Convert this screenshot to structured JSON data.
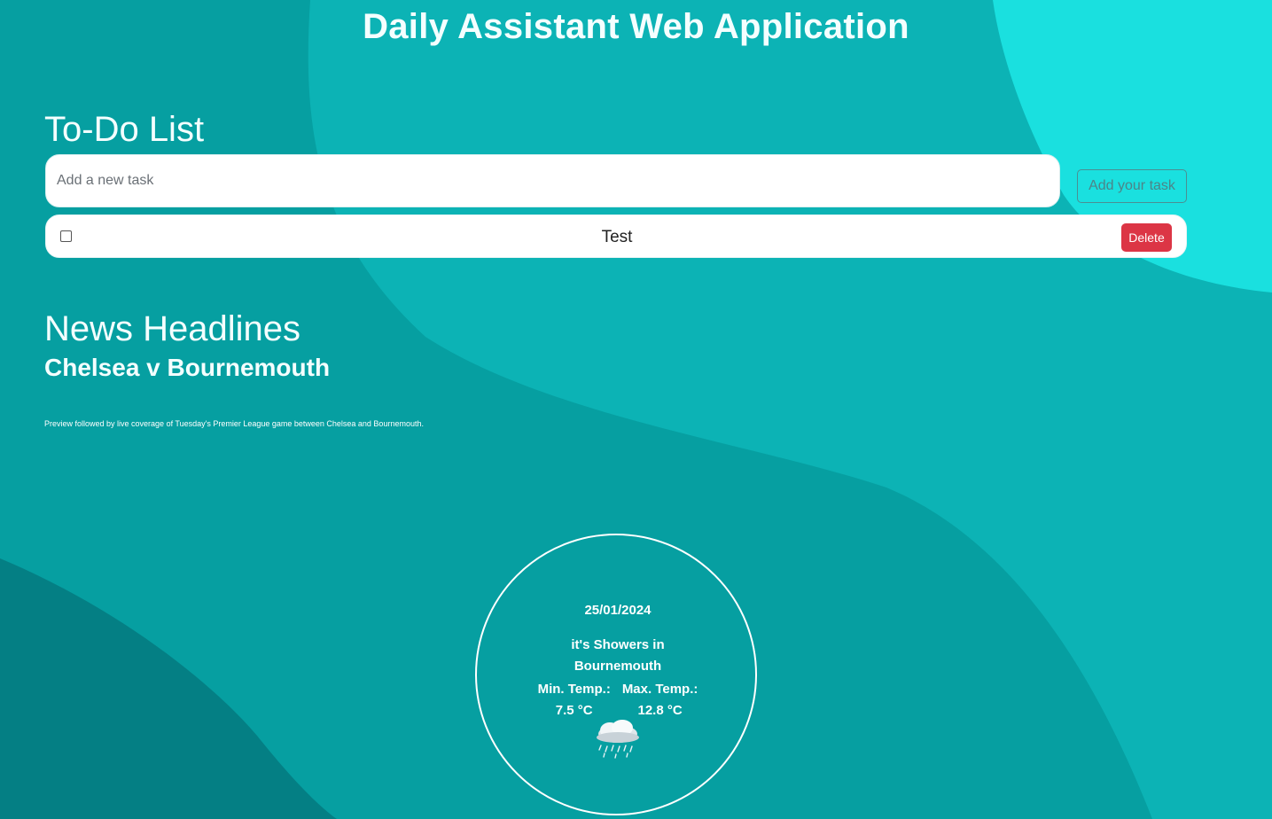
{
  "app": {
    "title": "Daily Assistant Web Application"
  },
  "todo": {
    "title": "To-Do List",
    "input_placeholder": "Add a new task",
    "input_value": "",
    "add_button_label": "Add your task",
    "tasks": [
      {
        "label": "Test",
        "checked": false,
        "delete_label": "Delete"
      }
    ]
  },
  "news": {
    "title": "News Headlines",
    "headline": "Chelsea v Bournemouth",
    "summary": "Preview followed by live coverage of Tuesday's Premier League game between Chelsea and Bournemouth."
  },
  "weather": {
    "date": "25/01/2024",
    "condition_text": "it's Showers in Bournemouth",
    "min_label": "Min. Temp.:",
    "min_value": "7.5 °C",
    "max_label": "Max. Temp.:",
    "max_value": "12.8 °C",
    "icon": "showers-cloud-icon"
  },
  "colors": {
    "background": "#0fb9bb",
    "delete_button": "#dc3545",
    "add_button_border": "#4b8f93"
  }
}
